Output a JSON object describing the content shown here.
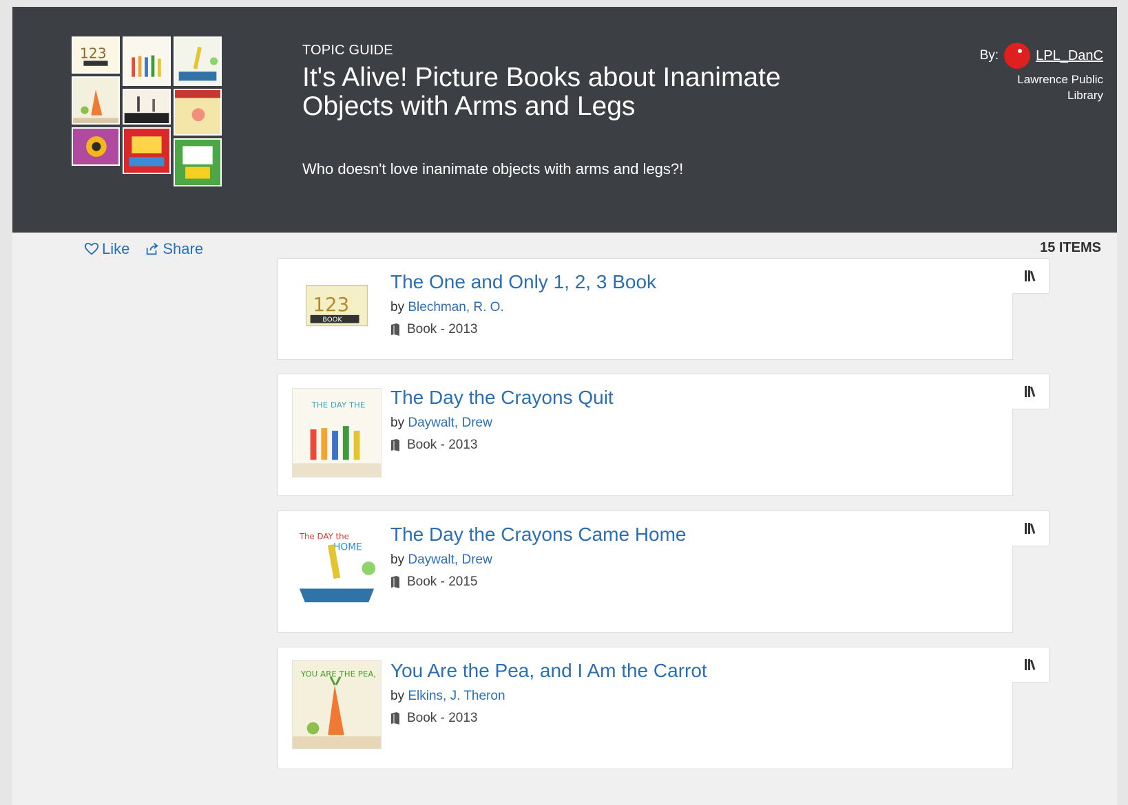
{
  "header": {
    "topic_label": "TOPIC GUIDE",
    "title": "It's Alive! Picture Books about Inanimate Objects with Arms and Legs",
    "description": "Who doesn't love inanimate objects with arms and legs?!",
    "by_label": "By:",
    "author": "LPL_DanC",
    "organization_line1": "Lawrence Public",
    "organization_line2": "Library",
    "avatar_color": "#e01f1f"
  },
  "actions": {
    "like_label": "Like",
    "share_label": "Share"
  },
  "list": {
    "count_label": "15 ITEMS",
    "items": [
      {
        "title": "The One and Only 1, 2, 3 Book",
        "by": "by",
        "author": "Blechman, R. O.",
        "format": "Book - 2013"
      },
      {
        "title": "The Day the Crayons Quit",
        "by": "by",
        "author": "Daywalt, Drew",
        "format": "Book - 2013"
      },
      {
        "title": "The Day the Crayons Came Home",
        "by": "by",
        "author": "Daywalt, Drew",
        "format": "Book - 2015"
      },
      {
        "title": "You Are the Pea, and I Am the Carrot",
        "by": "by",
        "author": "Elkins, J. Theron",
        "format": "Book - 2013"
      }
    ]
  },
  "colors": {
    "header_bg": "#3c3f44",
    "link": "#2a6fb3",
    "page_bg": "#f0f0f0"
  },
  "icons": [
    "heart-icon",
    "share-icon",
    "bookshelf-icon",
    "book-icon"
  ]
}
